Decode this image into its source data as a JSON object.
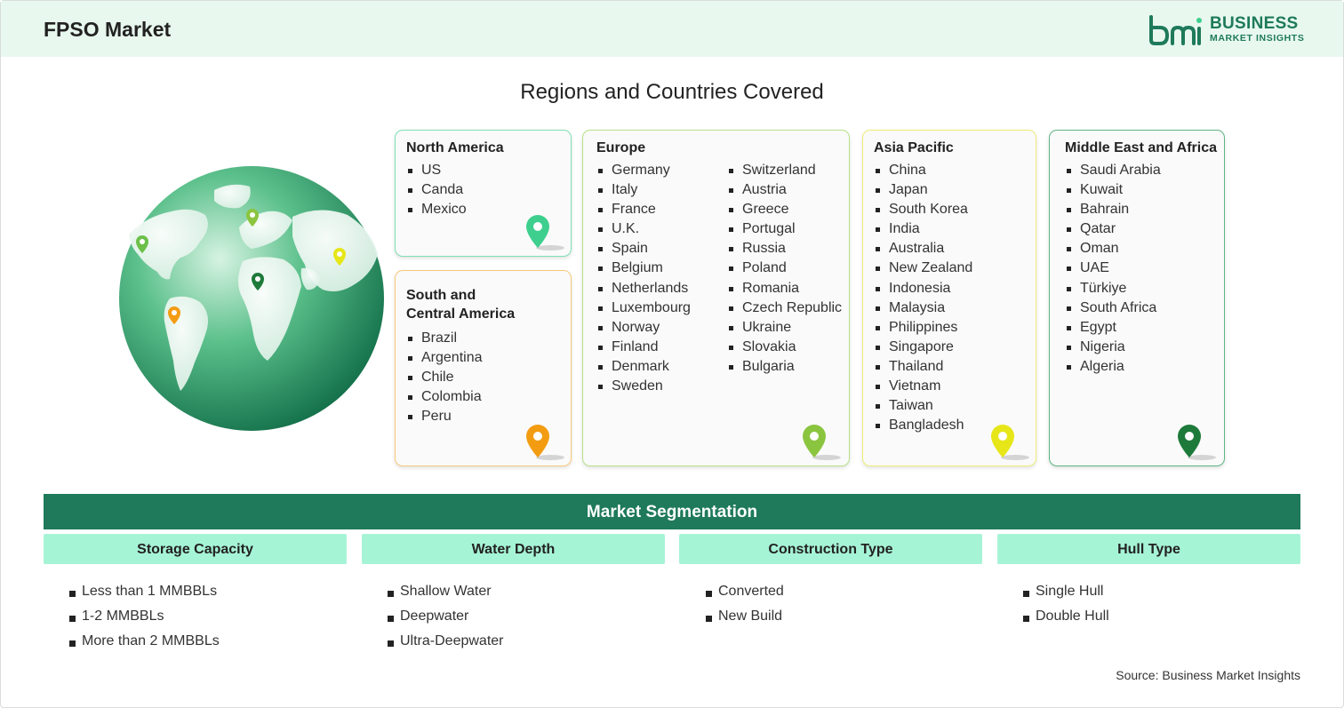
{
  "header": {
    "title": "FPSO Market"
  },
  "logo": {
    "line1": "BUSINESS",
    "line2": "MARKET INSIGHTS"
  },
  "section_title": "Regions and Countries Covered",
  "regions": {
    "north_america": {
      "title": "North America",
      "items": [
        "US",
        "Canda",
        "Mexico"
      ],
      "color": "#3ecf8e"
    },
    "south_america": {
      "title_line1": "South and",
      "title_line2": "Central America",
      "items": [
        "Brazil",
        "Argentina",
        "Chile",
        "Colombia",
        "Peru"
      ],
      "color": "#f39c12"
    },
    "europe": {
      "title": "Europe",
      "col1": [
        "Germany",
        "Italy",
        "France",
        "U.K.",
        "Spain",
        "Belgium",
        "Netherlands",
        "Luxembourg",
        "Norway",
        "Finland",
        "Denmark",
        "Sweden"
      ],
      "col2": [
        "Switzerland",
        "Austria",
        "Greece",
        "Portugal",
        "Russia",
        "Poland",
        "Romania",
        "Czech Republic",
        "Ukraine",
        "Slovakia",
        "Bulgaria"
      ],
      "color": "#8bc53f"
    },
    "asia_pacific": {
      "title": "Asia Pacific",
      "items": [
        "China",
        "Japan",
        "South Korea",
        "India",
        "Australia",
        "New Zealand",
        "Indonesia",
        "Malaysia",
        "Philippines",
        "Singapore",
        "Thailand",
        "Vietnam",
        "Taiwan",
        "Bangladesh"
      ],
      "color": "#e6e619"
    },
    "mea": {
      "title": "Middle East and Africa",
      "items": [
        "Saudi Arabia",
        "Kuwait",
        "Bahrain",
        "Qatar",
        "Oman",
        "UAE",
        "Türkiye",
        "South Africa",
        "Egypt",
        "Nigeria",
        "Algeria"
      ],
      "color": "#1e7a3a"
    }
  },
  "segmentation": {
    "title": "Market Segmentation",
    "columns": [
      {
        "header": "Storage Capacity",
        "items": [
          "Less than 1 MMBBLs",
          "1-2 MMBBLs",
          "More than 2 MMBBLs"
        ]
      },
      {
        "header": "Water Depth",
        "items": [
          "Shallow Water",
          "Deepwater",
          "Ultra-Deepwater"
        ]
      },
      {
        "header": "Construction Type",
        "items": [
          "Converted",
          "New Build"
        ]
      },
      {
        "header": "Hull Type",
        "items": [
          "Single Hull",
          "Double Hull"
        ]
      }
    ]
  },
  "source": "Source: Business Market Insights",
  "icons": [
    "globe-icon",
    "map-pin-icon",
    "logo-mark-icon"
  ]
}
